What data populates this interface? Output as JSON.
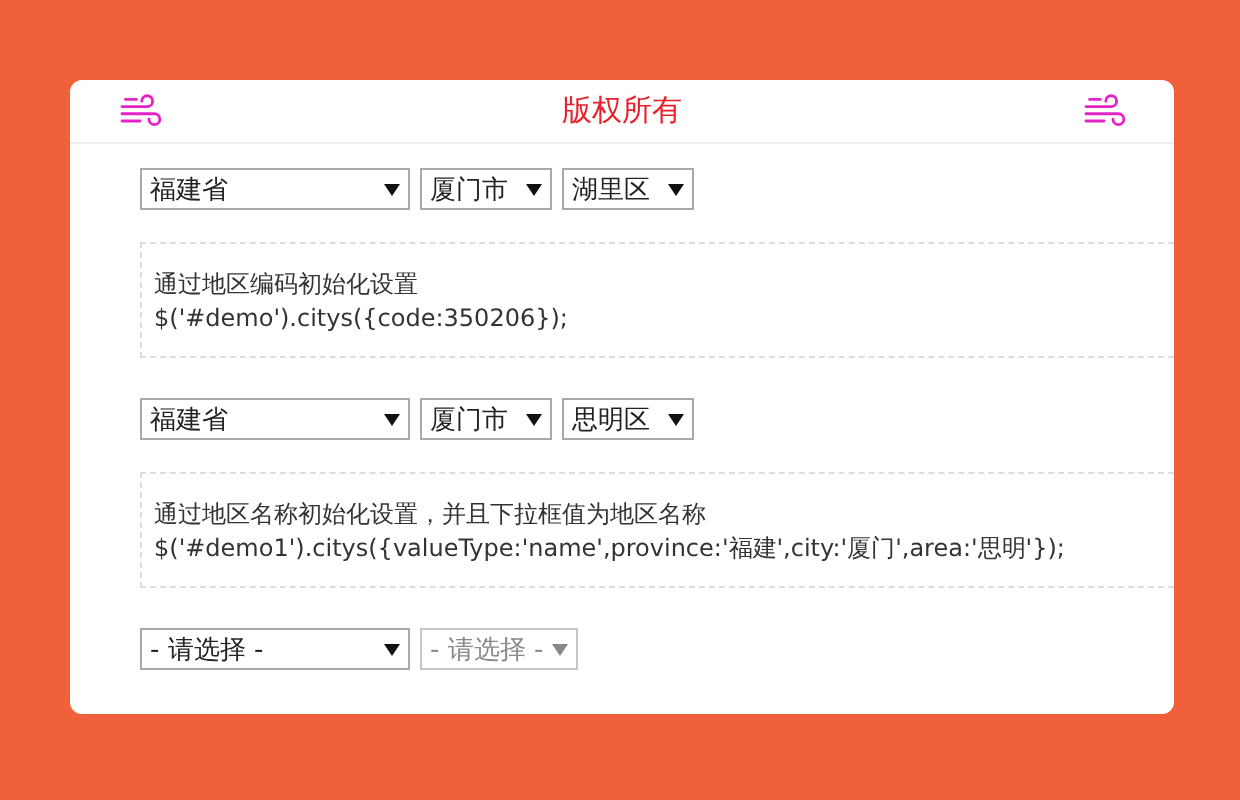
{
  "header": {
    "title": "版权所有"
  },
  "demos": [
    {
      "selects": [
        {
          "value": "福建省",
          "disabled": false
        },
        {
          "value": "厦门市",
          "disabled": false
        },
        {
          "value": "湖里区",
          "disabled": false
        }
      ],
      "note": {
        "description": "通过地区编码初始化设置",
        "code": "$('#demo').citys({code:350206});"
      }
    },
    {
      "selects": [
        {
          "value": "福建省",
          "disabled": false
        },
        {
          "value": "厦门市",
          "disabled": false
        },
        {
          "value": "思明区",
          "disabled": false
        }
      ],
      "note": {
        "description": "通过地区名称初始化设置，并且下拉框值为地区名称",
        "code": "$('#demo1').citys({valueType:'name',province:'福建',city:'厦门',area:'思明'});"
      }
    },
    {
      "selects": [
        {
          "value": "- 请选择 -",
          "disabled": false
        },
        {
          "value": "- 请选择 -",
          "disabled": true
        }
      ]
    }
  ]
}
